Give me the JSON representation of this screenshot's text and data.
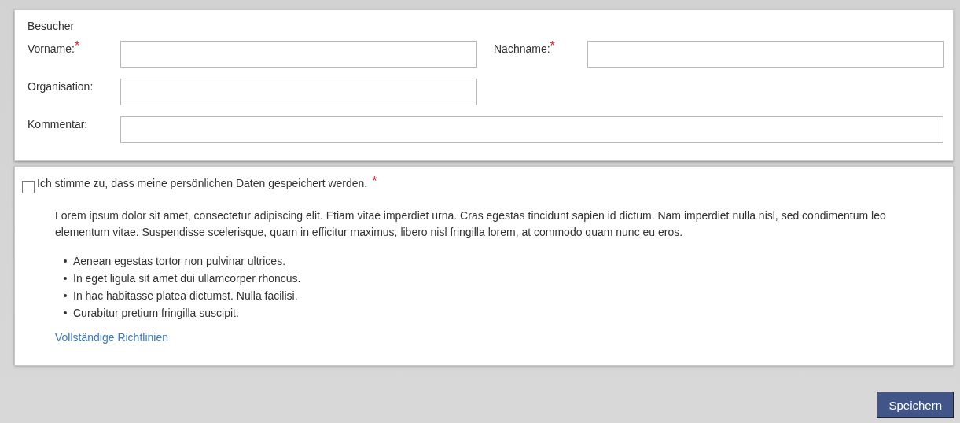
{
  "visitor": {
    "title": "Besucher",
    "fields": [
      {
        "label": "Vorname:",
        "mark": "*"
      },
      {
        "label": "Nachname:",
        "mark": "*"
      },
      {
        "label": "Organisation:"
      },
      {
        "label": "Kommentar:"
      }
    ]
  },
  "consent": {
    "checked": false,
    "label": "Ich stimme zu, dass meine persönlichen Daten gespeichert werden.",
    "mark": "*",
    "text": "Lorem ipsum dolor sit amet, consectetur adipiscing elit. Etiam vitae imperdiet urna. Cras egestas tincidunt sapien id dictum. Nam imperdiet nulla nisl, sed condimentum leo elementum vitae. Suspendisse scelerisque, quam in efficitur maximus, libero nisl fringilla lorem, at commodo quam nunc eu eros.",
    "bullets": [
      "Aenean egestas tortor non pulvinar ultrices.",
      "In eget ligula sit amet dui ullamcorper rhoncus.",
      "In hac habitasse platea dictumst. Nulla facilisi.",
      "Curabitur pretium fringilla suscipit."
    ],
    "link": "Vollständige Richtlinien"
  },
  "button": "Speichern"
}
